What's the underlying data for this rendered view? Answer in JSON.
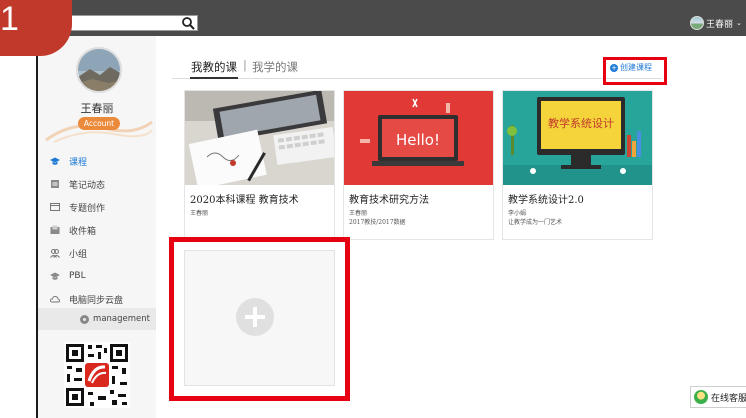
{
  "step_badge": "1",
  "topbar": {
    "search_placeholder": "",
    "user_name": "王春丽",
    "user_menu_chevron": "⌄"
  },
  "sidebar": {
    "user_name": "王春丽",
    "account_label": "Account",
    "items": [
      {
        "label": "课程",
        "icon": "graduation-cap-icon",
        "active": true
      },
      {
        "label": "笔记动态",
        "icon": "notes-icon",
        "active": false
      },
      {
        "label": "专题创作",
        "icon": "topic-icon",
        "active": false
      },
      {
        "label": "收件箱",
        "icon": "inbox-icon",
        "active": false
      },
      {
        "label": "小组",
        "icon": "group-icon",
        "active": false
      },
      {
        "label": "PBL",
        "icon": "pbl-icon",
        "active": false
      },
      {
        "label": "电脑同步云盘",
        "icon": "cloud-icon",
        "active": false
      }
    ],
    "management_label": "management"
  },
  "tabs": {
    "mine": "我教的课",
    "separator": "|",
    "learning": "我学的课"
  },
  "create_course_label": "创建课程",
  "courses": [
    {
      "title": "2020本科课程 教育技术",
      "meta_line1": "王春丽",
      "meta_line2": ""
    },
    {
      "title": "教育技术研究方法",
      "meta_line1": "王春丽",
      "meta_line2": "2017教技/2017数据",
      "image_text": "Hello!"
    },
    {
      "title": "教学系统设计2.0",
      "meta_line1": "李小娟",
      "meta_line2": "让教学成为一门艺术",
      "image_text": "教学系统设计"
    }
  ],
  "online_service_label": "在线客服",
  "colors": {
    "accent_blue": "#1f7ad6",
    "highlight_red": "#e60012",
    "badge_red": "#c0392b",
    "account_orange": "#ec8a3c",
    "topbar_bg": "#4b4b4b"
  }
}
